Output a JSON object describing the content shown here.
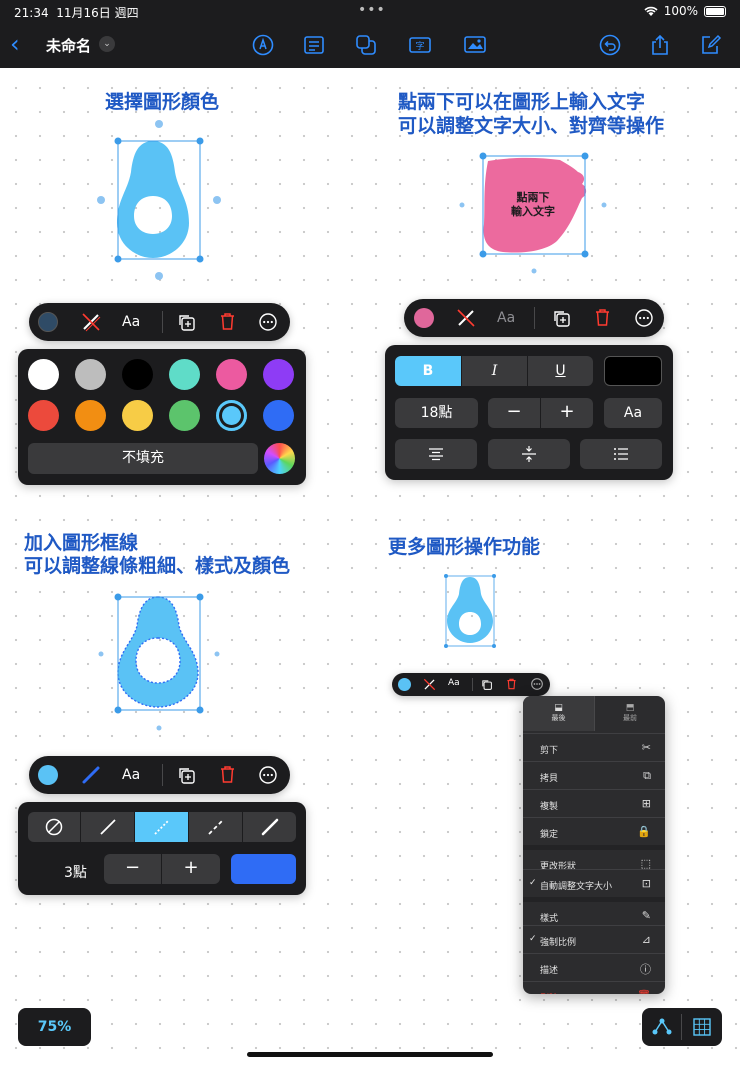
{
  "status": {
    "time": "21:34",
    "date": "11月16日 週四",
    "battery": "100%"
  },
  "toolbar": {
    "title": "未命名"
  },
  "headings": {
    "fill": "選擇圖形顏色",
    "text_line1": "點兩下可以在圖形上輸入文字",
    "text_line2": "可以調整文字大小、對齊等操作",
    "border_line1": "加入圖形框線",
    "border_line2": "可以調整線條粗細、樣式及顏色",
    "more": "更多圖形操作功能"
  },
  "shape_text": {
    "line1": "點兩下",
    "line2": "輸入文字"
  },
  "colors": {
    "accent": "#2f8cff",
    "heading": "#1f59c4",
    "shape_blue": "#5ac2f5",
    "shape_pink": "#ec6a9e",
    "delete_red": "#ff3b30",
    "selected_blue": "#5ac8fa"
  },
  "fill_panel": {
    "aa": "Aa",
    "swatches": [
      "#ffffff",
      "#bdbdbd",
      "#000000",
      "#5fdcc8",
      "#ec5aa0",
      "#8e3cf5",
      "#ec4a3c",
      "#f28e12",
      "#f7cc46",
      "#5cc46c",
      "#5ac8fa",
      "#2f6cf5"
    ],
    "no_fill": "不填充"
  },
  "text_panel": {
    "aa_pill": "Aa",
    "bold": "B",
    "italic": "I",
    "underline": "U",
    "size": "18點",
    "minus": "−",
    "plus": "+",
    "aa": "Aa"
  },
  "border_panel": {
    "aa": "Aa",
    "weight": "3點",
    "minus": "−",
    "plus": "+"
  },
  "more_panel": {
    "aa": "Aa",
    "menu_top": [
      "最後",
      "最前"
    ],
    "menu_items": [
      {
        "label": "剪下",
        "icon": "scissors-icon",
        "glyph": "✂"
      },
      {
        "label": "拷貝",
        "icon": "copy-icon",
        "glyph": "⧉"
      },
      {
        "label": "複製",
        "icon": "duplicate-icon",
        "glyph": "⊞"
      },
      {
        "label": "鎖定",
        "icon": "lock-icon",
        "glyph": "🔒"
      },
      {
        "label": "更改形狀",
        "icon": "shape-icon",
        "glyph": "⬚"
      },
      {
        "label": "自動調整文字大小",
        "icon": "autosize-icon",
        "glyph": "⊡",
        "checked": "✓"
      },
      {
        "label": "樣式",
        "icon": "pen-icon",
        "glyph": "✎"
      },
      {
        "label": "強制比例",
        "icon": "ratio-icon",
        "glyph": "⊿",
        "checked": "✓"
      },
      {
        "label": "描述",
        "icon": "info-icon",
        "glyph": "ⓘ"
      },
      {
        "label": "刪除",
        "icon": "trash-icon",
        "glyph": "🗑"
      }
    ]
  },
  "zoom": "75%"
}
